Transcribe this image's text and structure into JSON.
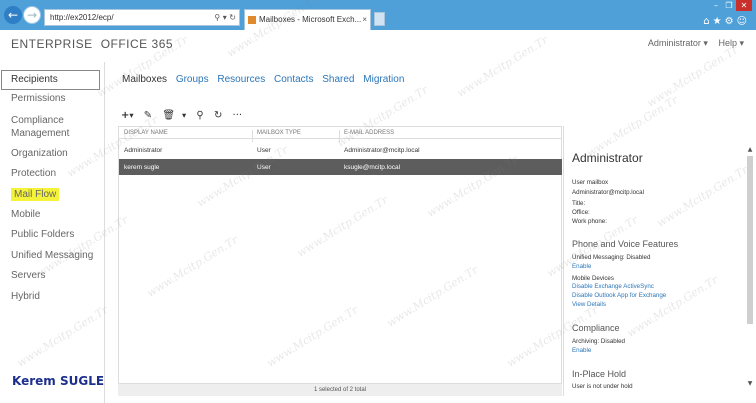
{
  "browser": {
    "url": "http://ex2012/ecp/",
    "tab_title": "Mailboxes - Microsoft Exch...",
    "back_icon": "back-arrow-icon",
    "forward_icon": "forward-arrow-icon"
  },
  "header": {
    "brand_enterprise": "ENTERPRISE",
    "brand_office": "OFFICE 365",
    "user_menu": "Administrator ▾",
    "help_menu": "Help ▾"
  },
  "leftnav": {
    "items": [
      {
        "label": "Recipients"
      },
      {
        "label": "Permissions"
      },
      {
        "label": "Compliance Management"
      },
      {
        "label": "Organization"
      },
      {
        "label": "Protection"
      },
      {
        "label": "Mail Flow"
      },
      {
        "label": "Mobile"
      },
      {
        "label": "Public Folders"
      },
      {
        "label": "Unified Messaging"
      },
      {
        "label": "Servers"
      },
      {
        "label": "Hybrid"
      }
    ]
  },
  "subtabs": [
    {
      "label": "Mailboxes"
    },
    {
      "label": "Groups"
    },
    {
      "label": "Resources"
    },
    {
      "label": "Contacts"
    },
    {
      "label": "Shared"
    },
    {
      "label": "Migration"
    }
  ],
  "toolbar": {
    "add": "+",
    "add_caret": "▾",
    "edit": "✎",
    "delete": "🗑",
    "delete_caret": "▾",
    "search": "⚲",
    "refresh": "↻",
    "more": "···"
  },
  "grid": {
    "columns": [
      "DISPLAY NAME",
      "MAILBOX TYPE",
      "E-MAIL ADDRESS"
    ],
    "rows": [
      {
        "name": "Administrator",
        "type": "User",
        "email": "Administrator@mcitp.local"
      },
      {
        "name": "kerem sugle",
        "type": "User",
        "email": "ksugle@mcitp.local"
      }
    ],
    "footer": "1 selected of 2 total"
  },
  "details": {
    "title": "Administrator",
    "type": "User mailbox",
    "email": "Administrator@mcitp.local",
    "title_field": "Title:",
    "office_field": "Office:",
    "phone_field": "Work phone:",
    "phone_section": "Phone and Voice Features",
    "um_status": "Unified Messaging: Disabled",
    "um_enable": "Enable",
    "mobile_devices": "Mobile Devices",
    "disable_activesync": "Disable Exchange ActiveSync",
    "disable_owa_app": "Disable Outlook App for Exchange",
    "view_details": "View Details",
    "compliance_section": "Compliance",
    "archiving": "Archiving: Disabled",
    "archiving_enable": "Enable",
    "hold_section": "In-Place Hold",
    "hold_status": "User is not under hold"
  },
  "watermark": {
    "text": "www.Mcitp.Gen.Tr"
  },
  "signature": {
    "text": "Kerem SUGLE"
  }
}
